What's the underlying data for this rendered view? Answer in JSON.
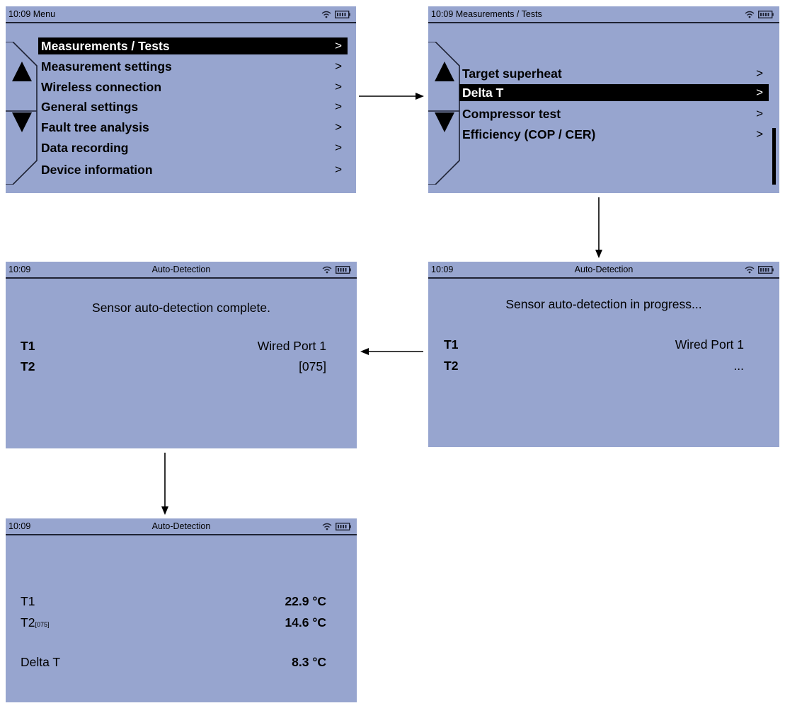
{
  "screens": {
    "menu": {
      "time": "10:09",
      "title": "Menu",
      "items": [
        {
          "label": "Measurements / Tests",
          "chevron": ">"
        },
        {
          "label": "Measurement settings",
          "chevron": ">"
        },
        {
          "label": "Wireless connection",
          "chevron": ">"
        },
        {
          "label": "General settings",
          "chevron": ">"
        },
        {
          "label": "Fault tree analysis",
          "chevron": ">"
        },
        {
          "label": "Data recording",
          "chevron": ">"
        },
        {
          "label": "Device information",
          "chevron": ">"
        }
      ],
      "selected_index": 0
    },
    "tests": {
      "time": "10:09",
      "title": "Measurements / Tests",
      "items": [
        {
          "label": "Target superheat",
          "chevron": ">"
        },
        {
          "label": "Delta T",
          "chevron": ">"
        },
        {
          "label": "Compressor test",
          "chevron": ">"
        },
        {
          "label": "Efficiency (COP / CER)",
          "chevron": ">"
        }
      ],
      "selected_index": 1
    },
    "detect_progress": {
      "time": "10:09",
      "title": "Auto-Detection",
      "message": "Sensor auto-detection in progress...",
      "rows": [
        {
          "label": "T1",
          "value": "Wired Port 1"
        },
        {
          "label": "T2",
          "value": "..."
        }
      ]
    },
    "detect_complete": {
      "time": "10:09",
      "title": "Auto-Detection",
      "message": "Sensor auto-detection complete.",
      "rows": [
        {
          "label": "T1",
          "value": "Wired Port 1"
        },
        {
          "label": "T2",
          "value": "[075]"
        }
      ]
    },
    "results": {
      "time": "10:09",
      "title": "Auto-Detection",
      "rows": [
        {
          "label": "T1",
          "sub": "",
          "value": "22.9 °C"
        },
        {
          "label": "T2",
          "sub": "[075]",
          "value": "14.6 °C"
        },
        {
          "label": "Delta T",
          "sub": "",
          "value": "8.3 °C"
        }
      ]
    }
  },
  "icons": {
    "status": [
      "wifi-icon",
      "battery-icon"
    ],
    "navigation": [
      "up-arrow-icon",
      "down-arrow-icon"
    ]
  },
  "colors": {
    "screen_background": "#97a5cf",
    "selection": "#000000",
    "selection_text": "#ffffff"
  }
}
